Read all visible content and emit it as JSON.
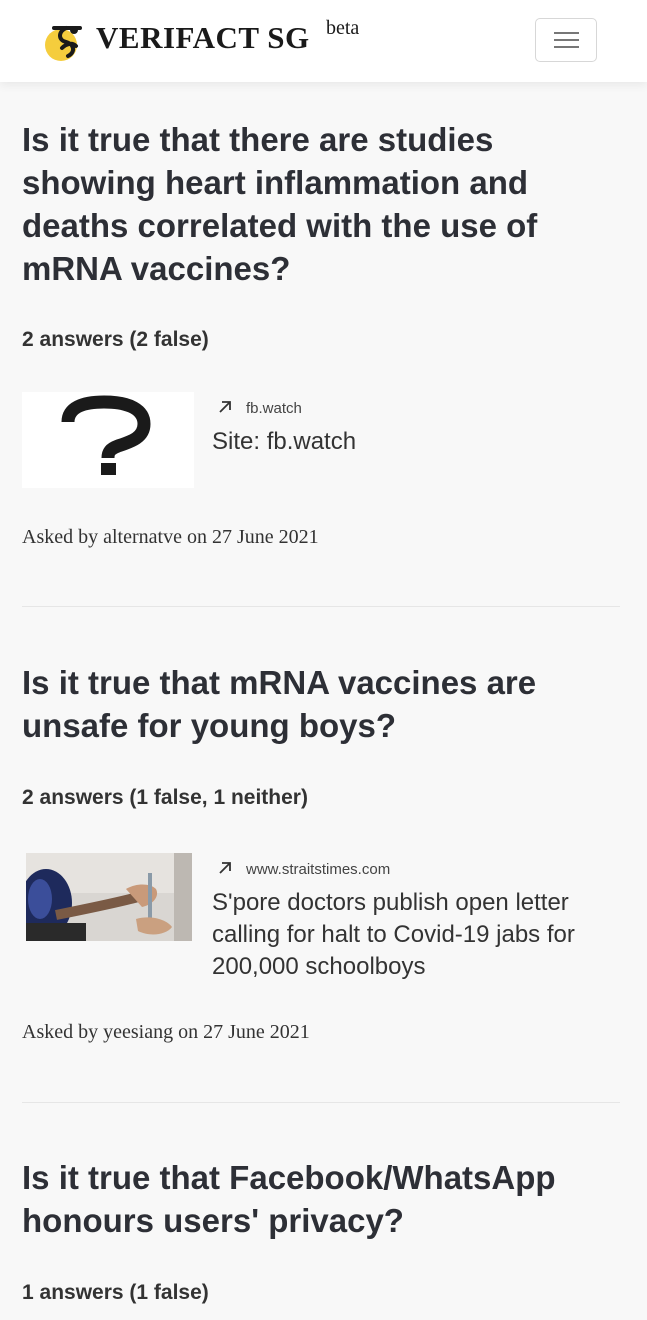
{
  "header": {
    "brand": "VERIFACT SG",
    "beta": "beta",
    "logo_icon": "bee-logo-icon",
    "menu_icon": "hamburger-menu-icon"
  },
  "questions": [
    {
      "title": "Is it true that there are studies showing heart inflammation and deaths correlated with the use of mRNA vaccines?",
      "answers": "2 answers (2 false)",
      "link": {
        "domain": "fb.watch",
        "title": "Site: fb.watch",
        "thumbnail": "question-mark-image"
      },
      "asked": "Asked by alternatve on 27 June 2021"
    },
    {
      "title": "Is it true that mRNA vaccines are unsafe for young boys?",
      "answers": "2 answers (1 false, 1 neither)",
      "link": {
        "domain": "www.straitstimes.com",
        "title": "S'pore doctors publish open letter calling for halt to Covid-19 jabs for 200,000 schoolboys",
        "thumbnail": "vaccination-photo"
      },
      "asked": "Asked by yeesiang on 27 June 2021"
    },
    {
      "title": "Is it true that Facebook/WhatsApp honours users' privacy?",
      "answers": "1 answers (1 false)"
    }
  ],
  "colors": {
    "background": "#f8f8f8",
    "navbar": "#ffffff",
    "logo_yellow": "#f5cd3d",
    "text": "#2d2f36"
  }
}
